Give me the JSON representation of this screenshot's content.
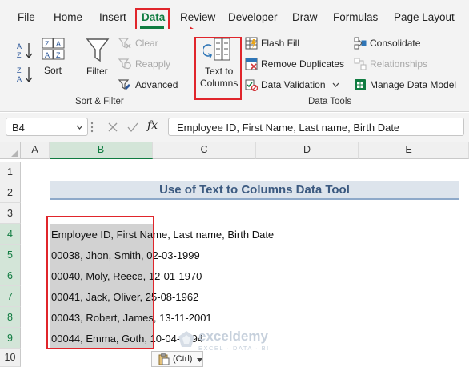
{
  "menu": {
    "tabs": [
      "File",
      "Home",
      "Insert",
      "Data",
      "Review",
      "Developer",
      "Draw",
      "Formulas",
      "Page Layout"
    ],
    "active_tab": "Data"
  },
  "ribbon": {
    "sort_filter": {
      "sort_label": "Sort",
      "filter_label": "Filter",
      "clear_label": "Clear",
      "reapply_label": "Reapply",
      "advanced_label": "Advanced",
      "group_label": "Sort & Filter"
    },
    "data_tools": {
      "text_to_columns_line1": "Text to",
      "text_to_columns_line2": "Columns",
      "flash_fill_label": "Flash Fill",
      "remove_duplicates_label": "Remove Duplicates",
      "data_validation_label": "Data Validation",
      "consolidate_label": "Consolidate",
      "relationships_label": "Relationships",
      "manage_data_model_label": "Manage Data Model",
      "group_label": "Data Tools"
    }
  },
  "formula_bar": {
    "name_box": "B4",
    "fx_symbol": "fx",
    "formula": "Employee ID, First Name, Last name, Birth Date"
  },
  "grid": {
    "columns": [
      "A",
      "B",
      "C",
      "D",
      "E"
    ],
    "selected_column": "B",
    "rows": [
      "1",
      "2",
      "3",
      "4",
      "5",
      "6",
      "7",
      "8",
      "9",
      "10"
    ],
    "title": "Use of Text to Columns Data Tool",
    "cells": [
      "Employee ID, First Name, Last name, Birth Date",
      "00038, Jhon, Smith, 02-03-1999",
      "00040, Moly, Reece, 12-01-1970",
      "00041, Jack, Oliver, 25-08-1962",
      "00043, Robert, James, 13-11-2001",
      "00044, Emma, Goth, 10-04-1994"
    ]
  },
  "paste_options_label": "(Ctrl)",
  "watermark": {
    "name": "exceldemy",
    "tagline": "EXCEL · DATA · BI"
  },
  "colors": {
    "excel_green": "#107c41",
    "highlight_red": "#e0252b",
    "title_text": "#3c5a80",
    "title_fill": "#dde4ec"
  }
}
